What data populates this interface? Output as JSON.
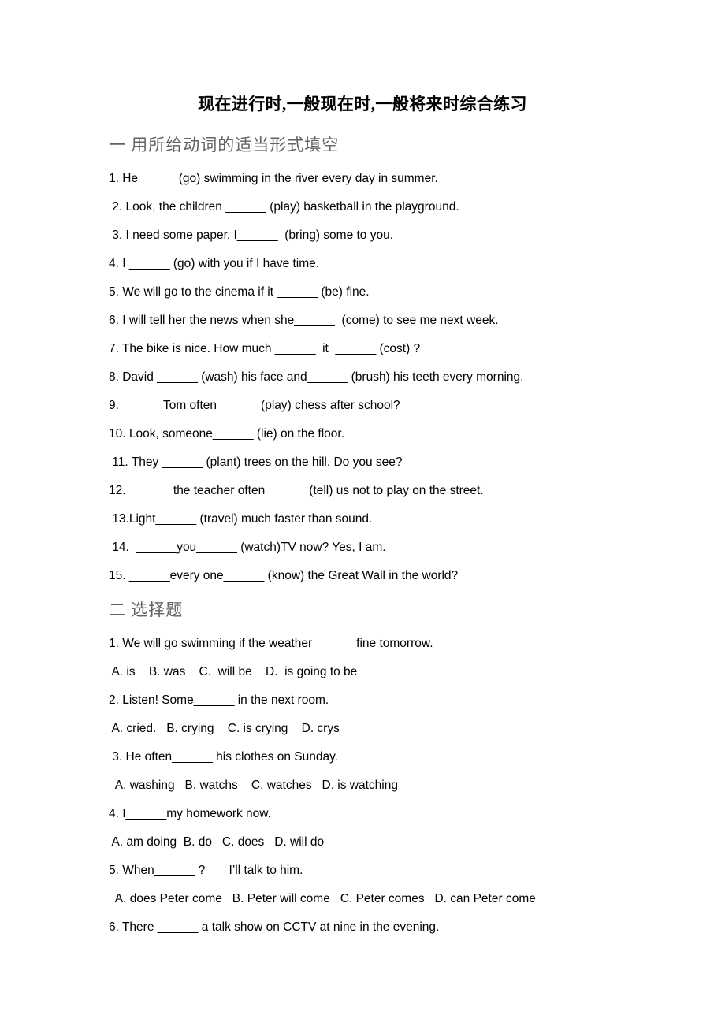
{
  "document": {
    "title": "现在进行时,一般现在时,一般将来时综合练习",
    "background_color": "#ffffff",
    "text_color": "#000000",
    "section_head_color": "#636363"
  },
  "sections": [
    {
      "heading": "一 用所给动词的适当形式填空",
      "lines": [
        "1. He______(go) swimming in the river every day in summer.",
        " 2. Look, the children ______ (play) basketball in the playground.",
        " 3. I need some paper, I______  (bring) some to you.",
        "4. I ______ (go) with you if I have time.",
        "5. We will go to the cinema if it ______ (be) fine.",
        "6. I will tell her the news when she______  (come) to see me next week.",
        "7. The bike is nice. How much ______  it  ______ (cost) ?",
        "8. David ______ (wash) his face and______ (brush) his teeth every morning.",
        "9. ______Tom often______ (play) chess after school?",
        "10. Look, someone______ (lie) on the floor.",
        " 11. They ______ (plant) trees on the hill. Do you see?",
        "12.  ______the teacher often______ (tell) us not to play on the street.",
        " 13.Light______ (travel) much faster than sound.",
        " 14.  ______you______ (watch)TV now? Yes, I am.",
        "15. ______every one______ (know) the Great Wall in the world?"
      ]
    },
    {
      "heading": "二 选择题",
      "lines": [
        "1. We will go swimming if the weather______ fine tomorrow.",
        " A. is    B. was    C.  will be    D.  is going to be",
        "2. Listen! Some______ in the next room.",
        " A. cried.   B. crying    C. is crying    D. crys",
        " 3. He often______ his clothes on Sunday.",
        "  A. washing   B. watchs    C. watches   D. is watching",
        "4. I______my homework now.",
        " A. am doing  B. do   C. does   D. will do",
        "5. When______ ?       I’ll talk to him.",
        "  A. does Peter come   B. Peter will come   C. Peter comes   D. can Peter come",
        "6. There ______ a talk show on CCTV at nine in the evening."
      ]
    }
  ],
  "layout": {
    "section1_line_tops": [
      216,
      252,
      288,
      324,
      360,
      396,
      432,
      468,
      504,
      540,
      576,
      612,
      648,
      684,
      720
    ],
    "section2_line_tops": [
      806,
      842,
      878,
      914,
      950,
      986,
      1022,
      1058,
      1094,
      1130,
      1166
    ]
  }
}
